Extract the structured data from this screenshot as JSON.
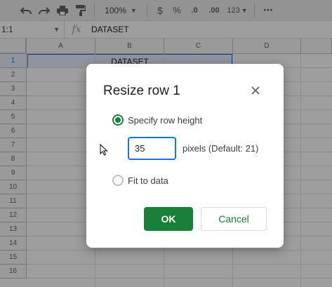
{
  "toolbar": {
    "zoom": "100%",
    "currency": "$",
    "percent": "%",
    "decrease_decimal": ".0",
    "increase_decimal": ".00",
    "more_formats": "123",
    "more": "⋯"
  },
  "formula_bar": {
    "name_box": "1:1",
    "fx": "fx",
    "content": "DATASET"
  },
  "grid": {
    "columns": [
      "A",
      "B",
      "C",
      "D"
    ],
    "rows": [
      "1",
      "2",
      "3",
      "4",
      "5",
      "6",
      "7",
      "8",
      "9",
      "10",
      "11",
      "12",
      "13",
      "14",
      "15",
      "16"
    ],
    "cell_b1": "DATASET"
  },
  "dialog": {
    "title": "Resize row 1",
    "option_specify": "Specify row height",
    "height_value": "35",
    "pixels_hint": "pixels (Default: 21)",
    "option_fit": "Fit to data",
    "ok_label": "OK",
    "cancel_label": "Cancel"
  },
  "icons": {
    "undo": "undo-icon",
    "redo": "redo-icon",
    "print": "print-icon",
    "paint_format": "paint-format-icon",
    "close": "close-icon"
  },
  "colors": {
    "accent_green": "#188038",
    "selection_blue": "#1a73e8"
  }
}
